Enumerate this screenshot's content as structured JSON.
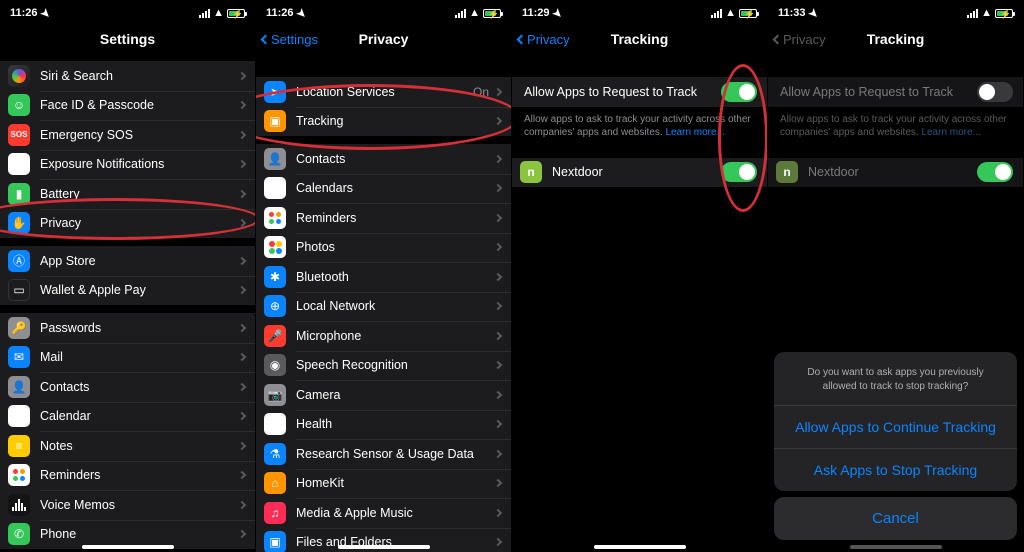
{
  "status": {
    "t1": "11:26",
    "t2": "11:26",
    "t3": "11:29",
    "t4": "11:33"
  },
  "s1": {
    "title": "Settings",
    "g1": [
      "Siri & Search",
      "Face ID & Passcode",
      "Emergency SOS",
      "Exposure Notifications",
      "Battery",
      "Privacy"
    ],
    "g2": [
      "App Store",
      "Wallet & Apple Pay"
    ],
    "g3": [
      "Passwords",
      "Mail",
      "Contacts",
      "Calendar",
      "Notes",
      "Reminders",
      "Voice Memos",
      "Phone"
    ]
  },
  "s2": {
    "back": "Settings",
    "title": "Privacy",
    "g1": [
      {
        "l": "Location Services",
        "d": "On"
      },
      {
        "l": "Tracking",
        "d": ""
      }
    ],
    "g2": [
      "Contacts",
      "Calendars",
      "Reminders",
      "Photos",
      "Bluetooth",
      "Local Network",
      "Microphone",
      "Speech Recognition",
      "Camera",
      "Health",
      "Research Sensor & Usage Data",
      "HomeKit",
      "Media & Apple Music",
      "Files and Folders"
    ]
  },
  "s3": {
    "back": "Privacy",
    "title": "Tracking",
    "allow": "Allow Apps to Request to Track",
    "foot": "Allow apps to ask to track your activity across other companies' apps and websites. ",
    "learn": "Learn more...",
    "app": "Nextdoor"
  },
  "s4": {
    "back": "Privacy",
    "title": "Tracking",
    "allow": "Allow Apps to Request to Track",
    "foot": "Allow apps to ask to track your activity across other companies' apps and websites. ",
    "learn": "Learn more...",
    "app": "Nextdoor",
    "sheet": {
      "msg": "Do you want to ask apps you previously allowed to track to stop tracking?",
      "opt1": "Allow Apps to Continue Tracking",
      "opt2": "Ask Apps to Stop Tracking",
      "cancel": "Cancel"
    }
  }
}
